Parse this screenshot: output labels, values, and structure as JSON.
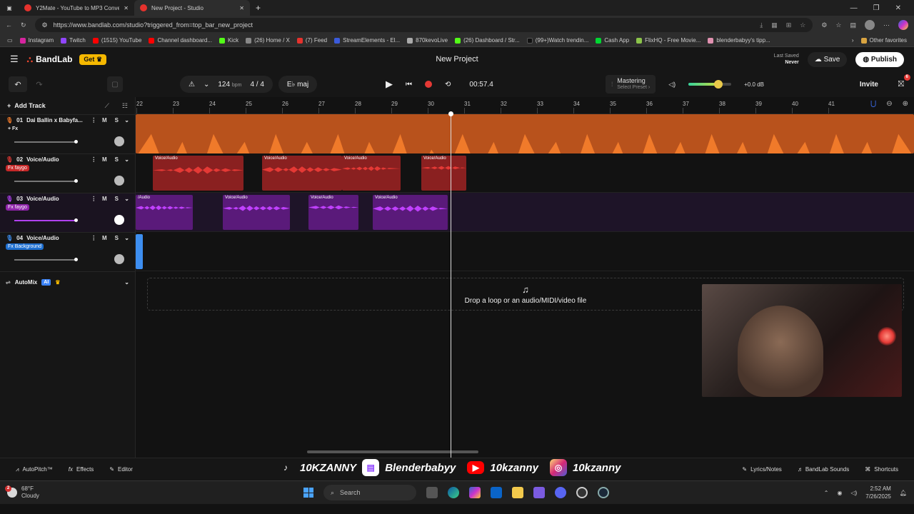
{
  "browser": {
    "tabs": [
      {
        "title": "Y2Mate - YouTube to MP3 Conve",
        "active": false
      },
      {
        "title": "New Project - Studio",
        "active": true
      }
    ],
    "url": "https://www.bandlab.com/studio?triggered_from=top_bar_new_project",
    "bookmarks": [
      {
        "label": "Instagram",
        "color": "#d6249f"
      },
      {
        "label": "Twitch",
        "color": "#9146ff"
      },
      {
        "label": "(1515) YouTube",
        "color": "#ff0000"
      },
      {
        "label": "Channel dashboard...",
        "color": "#ff0000"
      },
      {
        "label": "Kick",
        "color": "#53fc18"
      },
      {
        "label": "(26) Home / X",
        "color": "#888888"
      },
      {
        "label": "(7) Feed",
        "color": "#e5322d"
      },
      {
        "label": "StreamElements - El...",
        "color": "#3b5bdb"
      },
      {
        "label": "870kevoLive",
        "color": "#aaaaaa"
      },
      {
        "label": "(26) Dashboard / Str...",
        "color": "#53fc18"
      },
      {
        "label": "(99+)Watch trendin...",
        "color": "#111111"
      },
      {
        "label": "Cash App",
        "color": "#00d632"
      },
      {
        "label": "FlixHQ - Free Movie...",
        "color": "#8bc34a"
      },
      {
        "label": "blenderbabyy's tipp...",
        "color": "#e091b0"
      }
    ],
    "other_favorites": "Other favorites"
  },
  "header": {
    "logo": "BandLab",
    "get_label": "Get",
    "project_title": "New Project",
    "last_saved_label": "Last Saved",
    "last_saved_value": "Never",
    "save_label": "Save",
    "publish_label": "Publish",
    "notif_count": "6"
  },
  "transport": {
    "bpm": "124",
    "bpm_unit": "bpm",
    "time_sig_num": "4",
    "time_sig_den": "4",
    "key": "E♭ maj",
    "time": "00:57.4",
    "mastering_label": "Mastering",
    "mastering_sub": "Select Preset",
    "volume_db": "+0.0 dB",
    "volume_level": 0.7,
    "invite_label": "Invite"
  },
  "left_panel": {
    "add_track_label": "Add Track",
    "tracks": [
      {
        "num": "01",
        "name": "Dai Ballin x Babyfa...",
        "fx": "+ Fx",
        "fx_color": "transparent",
        "icon_color": "#f07a2a"
      },
      {
        "num": "02",
        "name": "Voice/Audio",
        "fx": "Fx faygo",
        "fx_color": "#c62828",
        "icon_color": "#e53935"
      },
      {
        "num": "03",
        "name": "Voice/Audio",
        "fx": "Fx faygo",
        "fx_color": "#8e24aa",
        "icon_color": "#b040f0"
      },
      {
        "num": "04",
        "name": "Voice/Audio",
        "fx": "Fx Background",
        "fx_color": "#1e6fd0",
        "icon_color": "#3d8ef0"
      }
    ],
    "mute_label": "M",
    "solo_label": "S",
    "automix_label": "AutoMix",
    "ai_label": "AI"
  },
  "timeline": {
    "ruler": [
      "22",
      "23",
      "24",
      "25",
      "26",
      "27",
      "28",
      "29",
      "30",
      "31",
      "32",
      "33",
      "34",
      "35",
      "36",
      "37",
      "38",
      "39",
      "40",
      "41"
    ],
    "drop_label": "Drop a loop or an audio/MIDI/video file",
    "clip_label": "Voice/Audio",
    "clip_label_partial": "/Audio"
  },
  "bottom": {
    "autopitch": "AutoPitch™",
    "effects": "Effects",
    "editor": "Editor",
    "lyrics": "Lyrics/Notes",
    "sounds": "BandLab Sounds",
    "shortcuts": "Shortcuts"
  },
  "overlay": {
    "tiktok": "10KZANNY",
    "twitch": "Blenderbabyy",
    "youtube": "10kzanny",
    "instagram": "10kzanny"
  },
  "taskbar": {
    "temp": "68°F",
    "weather": "Cloudy",
    "weather_badge": "2",
    "search": "Search",
    "time": "2:52 AM",
    "date": "7/26/2025"
  }
}
